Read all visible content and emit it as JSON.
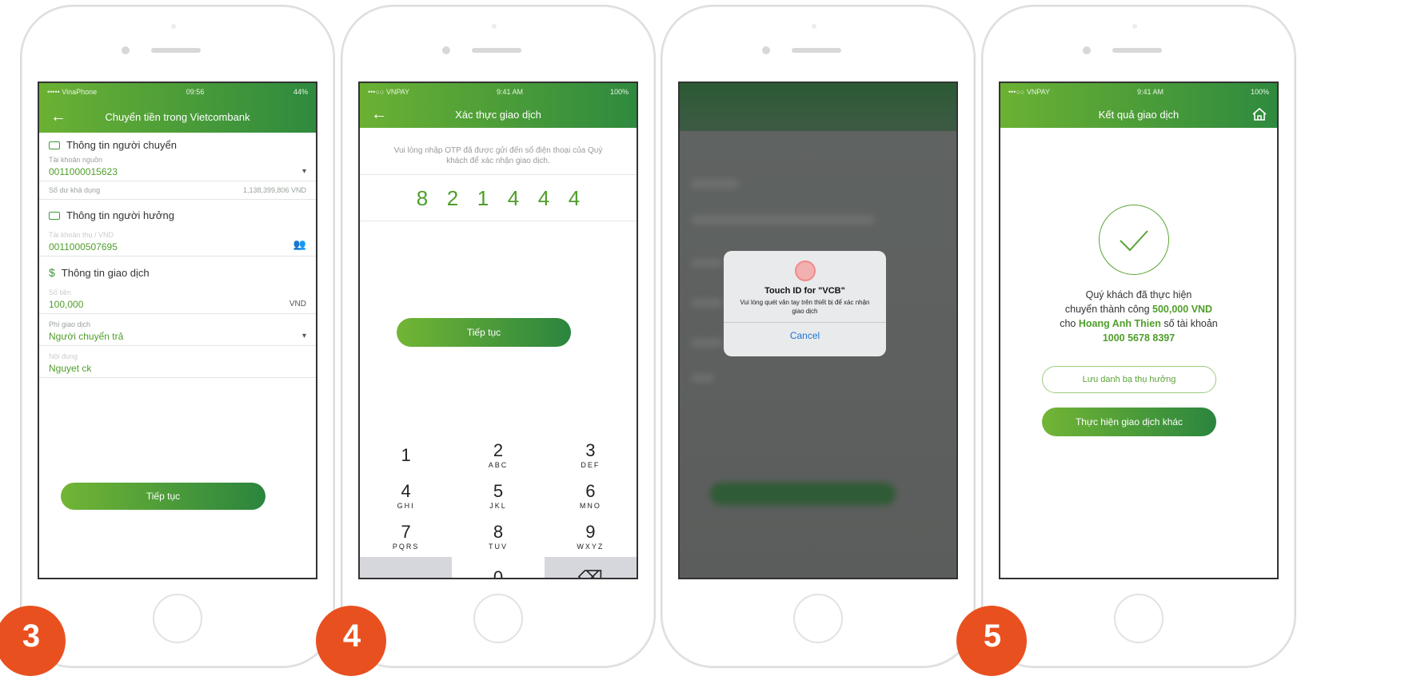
{
  "accent_color": "#4f9e2a",
  "badge_color": "#e9501f",
  "screen3": {
    "status": {
      "carrier": "••••• VinaPhone",
      "time": "09:56",
      "battery": "44%"
    },
    "title": "Chuyển tiền trong Vietcombank",
    "sender_header": "Thông tin người chuyển",
    "source_label": "Tài khoản nguồn",
    "source_value": "0011000015623",
    "balance_label": "Số dư khả dụng",
    "balance_value": "1,138,399,806 VND",
    "receiver_header": "Thông tin người hưởng",
    "receiver_label": "Tài khoản thụ / VND",
    "receiver_value": "0011000507695",
    "txn_header": "Thông tin giao dịch",
    "amount_label": "Số tiền",
    "amount_value": "100,000",
    "amount_currency": "VND",
    "fee_label": "Phí giao dịch",
    "fee_value": "Người chuyển trả",
    "content_label": "Nội dung",
    "content_value": "Nguyet ck",
    "continue_label": "Tiếp tục",
    "badge": "3"
  },
  "screen4": {
    "status": {
      "carrier": "•••○○ VNPAY",
      "time": "9:41 AM",
      "battery": "100%"
    },
    "title": "Xác thực giao dịch",
    "hint": "Vui lòng nhập OTP đã được gửi đến số điện thoại của Quý khách để xác nhận giao dịch.",
    "otp": [
      "8",
      "2",
      "1",
      "4",
      "4",
      "4"
    ],
    "continue_label": "Tiếp tục",
    "keys": [
      {
        "num": "1",
        "sub": ""
      },
      {
        "num": "2",
        "sub": "ABC"
      },
      {
        "num": "3",
        "sub": "DEF"
      },
      {
        "num": "4",
        "sub": "GHI"
      },
      {
        "num": "5",
        "sub": "JKL"
      },
      {
        "num": "6",
        "sub": "MNO"
      },
      {
        "num": "7",
        "sub": "PQRS"
      },
      {
        "num": "8",
        "sub": "TUV"
      },
      {
        "num": "9",
        "sub": "WXYZ"
      },
      {
        "num": "",
        "sub": ""
      },
      {
        "num": "0",
        "sub": ""
      },
      {
        "num": "⌫",
        "sub": ""
      }
    ],
    "badge": "4"
  },
  "screen_touch": {
    "alert_title": "Touch ID for \"VCB\"",
    "alert_message": "Vui lòng quét vân tay trên thiết bị để xác nhận giao dịch",
    "cancel_label": "Cancel"
  },
  "screen5": {
    "status": {
      "carrier": "•••○○ VNPAY",
      "time": "9:41 AM",
      "battery": "100%"
    },
    "title": "Kết quả giao dịch",
    "line1": "Quý khách đã thực hiện",
    "line2_prefix": "chuyển thành công ",
    "amount": "500,000 VND",
    "line3_prefix": "cho ",
    "recipient": "Hoang Anh Thien",
    "line3_suffix": " số tài khoản",
    "account": "1000 5678 8397",
    "save_label": "Lưu danh bạ thụ hưởng",
    "other_label": "Thực hiện giao dịch khác",
    "badge": "5"
  }
}
